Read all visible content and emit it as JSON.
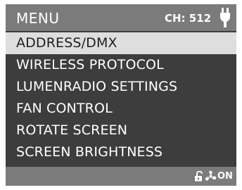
{
  "header": {
    "title": "MENU",
    "channel_label": "CH: 512",
    "status_icon": "plug-icon"
  },
  "menu": {
    "selected_index": 0,
    "items": [
      {
        "label": "ADDRESS/DMX"
      },
      {
        "label": "WIRELESS PROTOCOL"
      },
      {
        "label": "LUMENRADIO SETTINGS"
      },
      {
        "label": "FAN CONTROL"
      },
      {
        "label": "ROTATE SCREEN"
      },
      {
        "label": "SCREEN BRIGHTNESS"
      }
    ]
  },
  "footer": {
    "lock_icon": "unlocked-icon",
    "fan_icon": "fan-icon",
    "fan_state": "ON"
  },
  "colors": {
    "screen_background": "#3d3d3d",
    "header_footer_background": "#7b7b7b",
    "selected_row": "#dedede",
    "text": "#ffffff",
    "selected_text": "#1f1f1f"
  }
}
